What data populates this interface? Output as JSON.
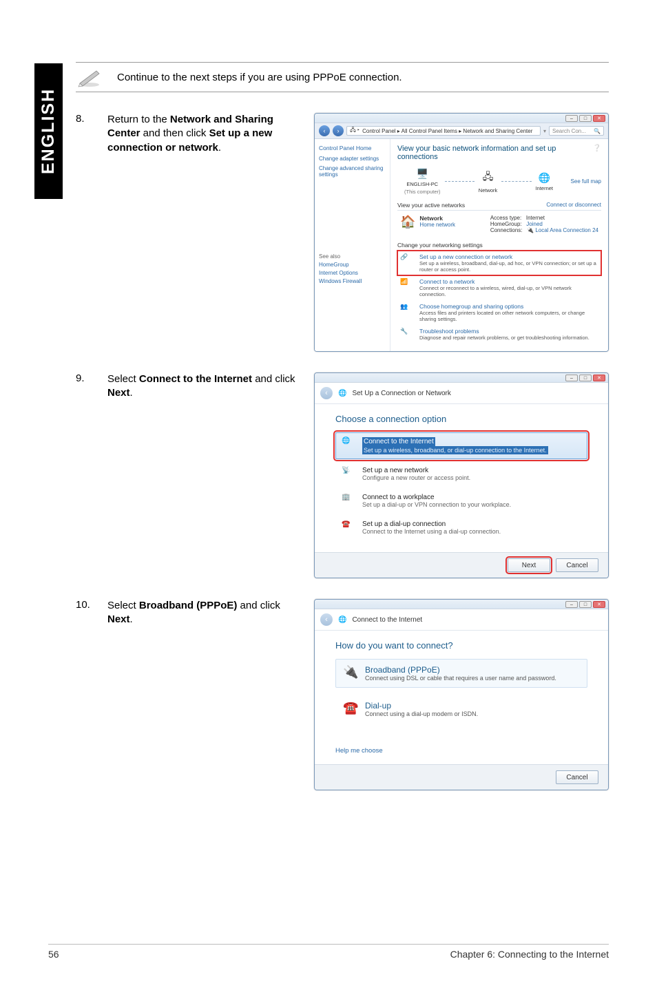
{
  "side_tab": "ENGLISH",
  "note": "Continue to the next steps if you are using PPPoE connection.",
  "steps": {
    "s8": {
      "num": "8.",
      "text_pre": "Return to the ",
      "bold1": "Network and Sharing Center",
      "text_mid": " and then click ",
      "bold2": "Set up a new connection or network",
      "text_post": "."
    },
    "s9": {
      "num": "9.",
      "text_pre": "Select ",
      "bold1": "Connect to the Internet",
      "text_mid": " and click ",
      "bold2": "Next",
      "text_post": "."
    },
    "s10": {
      "num": "10.",
      "text_pre": "Select ",
      "bold1": "Broadband (PPPoE)",
      "text_mid": " and click ",
      "bold2": "Next",
      "text_post": "."
    }
  },
  "shot1": {
    "breadcrumb": "Control Panel  ▸  All Control Panel Items  ▸  Network and Sharing Center",
    "search_placeholder": "Search Con...",
    "side_header": "Control Panel Home",
    "side_links": [
      "Change adapter settings",
      "Change advanced sharing settings"
    ],
    "title": "View your basic network information and set up connections",
    "full_map": "See full map",
    "node1": "ENGLISH-PC",
    "node1b": "(This computer)",
    "node2": "Network",
    "node3": "Internet",
    "active_title": "View your active networks",
    "active_right": "Connect or disconnect",
    "net_name": "Network",
    "net_type": "Home network",
    "acc_type_l": "Access type:",
    "acc_type_v": "Internet",
    "hg_l": "HomeGroup:",
    "hg_v": "Joined",
    "conn_l": "Connections:",
    "conn_v": "Local Area Connection 24",
    "change_title": "Change your networking settings",
    "tasks": [
      {
        "t": "Set up a new connection or network",
        "d": "Set up a wireless, broadband, dial-up, ad hoc, or VPN connection; or set up a router or access point."
      },
      {
        "t": "Connect to a network",
        "d": "Connect or reconnect to a wireless, wired, dial-up, or VPN network connection."
      },
      {
        "t": "Choose homegroup and sharing options",
        "d": "Access files and printers located on other network computers, or change sharing settings."
      },
      {
        "t": "Troubleshoot problems",
        "d": "Diagnose and repair network problems, or get troubleshooting information."
      }
    ],
    "see_also_title": "See also",
    "see_also": [
      "HomeGroup",
      "Internet Options",
      "Windows Firewall"
    ]
  },
  "shot2": {
    "header": "Set Up a Connection or Network",
    "title": "Choose a connection option",
    "options": [
      {
        "t": "Connect to the Internet",
        "d": "Set up a wireless, broadband, or dial-up connection to the Internet."
      },
      {
        "t": "Set up a new network",
        "d": "Configure a new router or access point."
      },
      {
        "t": "Connect to a workplace",
        "d": "Set up a dial-up or VPN connection to your workplace."
      },
      {
        "t": "Set up a dial-up connection",
        "d": "Connect to the Internet using a dial-up connection."
      }
    ],
    "next": "Next",
    "cancel": "Cancel"
  },
  "shot3": {
    "header": "Connect to the Internet",
    "title": "How do you want to connect?",
    "options": [
      {
        "t": "Broadband (PPPoE)",
        "d": "Connect using DSL or cable that requires a user name and password."
      },
      {
        "t": "Dial-up",
        "d": "Connect using a dial-up modem or ISDN."
      }
    ],
    "help": "Help me choose",
    "cancel": "Cancel"
  },
  "footer": {
    "page": "56",
    "chapter": "Chapter 6: Connecting to the Internet"
  }
}
